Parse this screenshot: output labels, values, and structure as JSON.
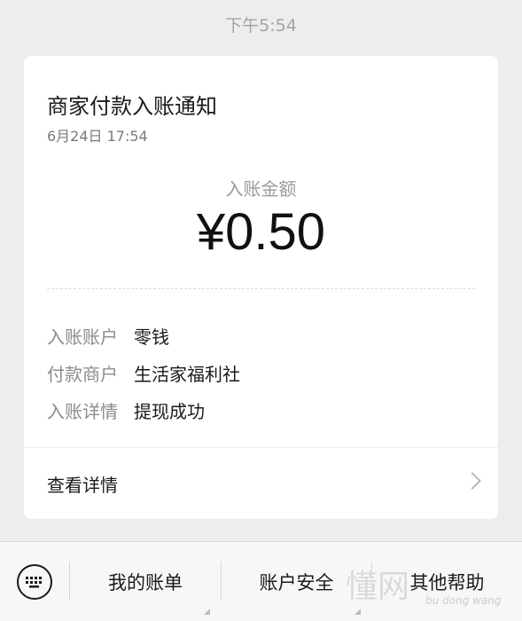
{
  "status": {
    "time": "下午5:54"
  },
  "card": {
    "title": "商家付款入账通知",
    "date": "6月24日  17:54",
    "amount_label": "入账金额",
    "amount": "¥0.50",
    "details": [
      {
        "key": "入账账户",
        "value": "零钱"
      },
      {
        "key": "付款商户",
        "value": "生活家福利社"
      },
      {
        "key": "入账详情",
        "value": "提现成功"
      }
    ],
    "view_details_label": "查看详情"
  },
  "bottom_menu": {
    "keyboard_icon": "keyboard-icon",
    "items": [
      {
        "label": "我的账单"
      },
      {
        "label": "账户安全"
      },
      {
        "label": "其他帮助"
      }
    ]
  },
  "watermark": {
    "text": "懂网",
    "small": "bu dong wang"
  }
}
